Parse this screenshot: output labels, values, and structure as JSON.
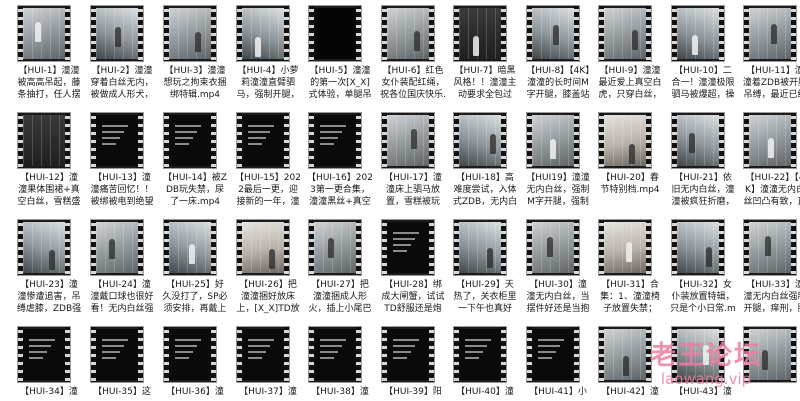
{
  "files": [
    {
      "label": "【HUI-1】潼潼被高高吊起，藤条抽打，任人摆",
      "style": "room"
    },
    {
      "label": "【HUI-2】潼潼穿着白丝无内，被做成人形犬，拴着",
      "style": "room2"
    },
    {
      "label": "【HUI-3】潼潼想玩之拘束衣捆绑特辑.mp4",
      "style": "room"
    },
    {
      "label": "【HUI-4】小萝莉潼潼直臂驷马，强制开腿，假[X_X]",
      "style": "room2"
    },
    {
      "label": "【HUI-5】潼潼的第一次[X_X]式体验，单腿吊缚，",
      "style": "black"
    },
    {
      "label": "【HUI-6】红色女仆装配红绳，祝各位国庆快乐.mp4",
      "style": "room"
    },
    {
      "label": "【HUI-7】暗黑风格！！潼潼主动要求全包过夜，结",
      "style": "dark"
    },
    {
      "label": "【HUI-8】【4K】潼潼的长时间M字开腿，膝盖站",
      "style": "room2"
    },
    {
      "label": "【HUI-9】潼潼最近爱上真空白虎，只穿白丝，曲腿",
      "style": "room"
    },
    {
      "label": "【HUI-10】二合一！潼潼极限驷马被爆超，操作失",
      "style": "room2"
    },
    {
      "label": "【HUI-11】潼潼着ZDB被开腿吊缚，最近已经习惯",
      "style": "room"
    },
    {
      "label": "【HUI-12】潼潼果体围裙+真空白丝，雪糕盛宴，双",
      "style": "dark"
    },
    {
      "label": "【HUI-13】潼潼痛苦回忆！！被绑被电到绝望哭了一",
      "style": "text"
    },
    {
      "label": "【HUI-14】被ZDB玩失禁，尿了一床.mp4",
      "style": "text"
    },
    {
      "label": "【HUI-15】2022最后一更，迎接新的一年，潼潼",
      "style": "text"
    },
    {
      "label": "【HUI-16】2023第一更合集，潼潼黑丝+真空白丝",
      "style": "text"
    },
    {
      "label": "【HUI-17】潼潼床上驷马放置，雪糕被玩弄，窒无抵",
      "style": "room"
    },
    {
      "label": "【HUI-18】高难度尝试，入体式ZDB，无内白丝，",
      "style": "room2"
    },
    {
      "label": "【HUI19】潼潼无内白丝，强制M字开腿，强制G",
      "style": "room"
    },
    {
      "label": "【HUI-20】春节特别档.mp4",
      "style": "bed"
    },
    {
      "label": "【HUI-21】依旧无内白丝，潼潼被疯狂折磨，挠痒弹",
      "style": "room2"
    },
    {
      "label": "【HUI-22】【4K】潼潼无内白丝凹凸有致，直臂极",
      "style": "room"
    },
    {
      "label": "【HUI-23】潼潼惨遭追害，吊缚虐膝，ZDB强高，",
      "style": "room2"
    },
    {
      "label": "【HUI-24】潼潼戴口球也很好看！无内白丝强高，口",
      "style": "room"
    },
    {
      "label": "【HUI-25】好久没打了，SP必须安排，再戴上口球玩",
      "style": "room2"
    },
    {
      "label": "【HUI-26】把潼潼捆好放床上，[X_X]TD放置，然后",
      "style": "bed"
    },
    {
      "label": "【HUI-27】把潼潼捆成人形火，插上小尾巴GS，很",
      "style": "room"
    },
    {
      "label": "【HUI-28】绑成大闸蟹，试试TD舒服还是炮机舒服，",
      "style": "text"
    },
    {
      "label": "【HUI-29】天热了，关衣柜里一下午也真好了，帮她子",
      "style": "room2"
    },
    {
      "label": "【HUI-30】潼潼无内白丝，当摆件好还是当抱枕好（",
      "style": "room"
    },
    {
      "label": "【HUI-31】合集：1、潼潼椅子放置失禁；2、穿网袜被",
      "style": "bed"
    },
    {
      "label": "【HUI-32】女仆装放置特辑，只是个小日常.mp4",
      "style": "room2"
    },
    {
      "label": "【HUI-33】潼潼无内白丝强制开腿，痒刑，股绳虐Y",
      "style": "room"
    },
    {
      "label": "【HUI-34】潼",
      "style": "text"
    },
    {
      "label": "【HUI-35】这",
      "style": "text"
    },
    {
      "label": "【HUI-36】潼",
      "style": "text"
    },
    {
      "label": "【HUI-37】潼",
      "style": "text"
    },
    {
      "label": "【HUI-38】潼",
      "style": "text"
    },
    {
      "label": "【HUI-39】阳",
      "style": "text"
    },
    {
      "label": "【HUI-40】潼",
      "style": "text"
    },
    {
      "label": "【HUI-41】小",
      "style": "text"
    },
    {
      "label": "【HUI-42】潼",
      "style": "room"
    },
    {
      "label": "【HUI-43】潼",
      "style": "room2"
    },
    {
      "label": "",
      "style": "room"
    }
  ],
  "watermark": {
    "title": "老王论坛",
    "url": "laowang.vip",
    "color": "#f07da0"
  }
}
